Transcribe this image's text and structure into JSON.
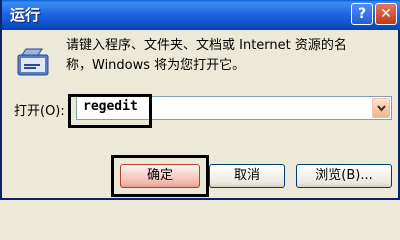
{
  "window": {
    "title": "运行",
    "help_button": "?",
    "close_button": "✕",
    "icon": "run-icon"
  },
  "description": {
    "line1": "请键入程序、文件夹、文档或 Internet 资源的名",
    "line2": "称，Windows 将为您打开它。"
  },
  "open_field": {
    "label": "打开(O):",
    "value": "regedit",
    "dropdown_icon": "chevron-down-icon"
  },
  "buttons": {
    "ok": "确定",
    "cancel": "取消",
    "browse": "浏览(B)..."
  },
  "colors": {
    "titlebar": "#2166e0",
    "dialog_bg": "#ece9d8",
    "highlight_box": "#000000",
    "close_button": "#c0371a"
  }
}
